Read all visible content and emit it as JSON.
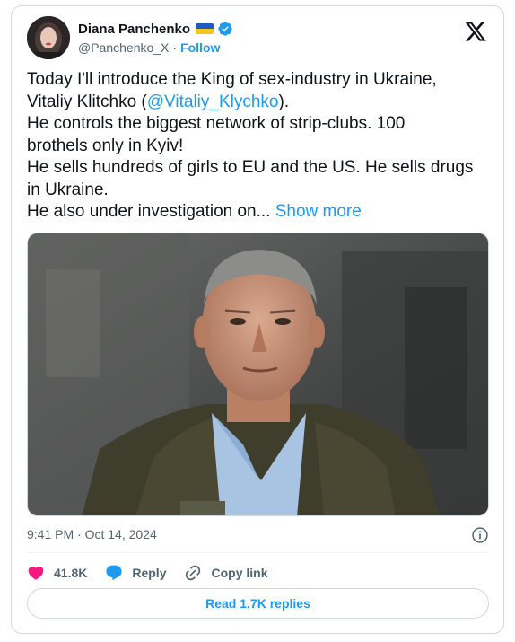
{
  "author": {
    "name": "Diana Panchenko",
    "handle": "@Panchenko_X",
    "separator": "·",
    "follow_label": "Follow",
    "flag_colors": [
      "#1d5bbf",
      "#f5c518"
    ],
    "verified_color": "#1d9bf0"
  },
  "tweet": {
    "line1": "Today I'll introduce the King of sex-industry in Ukraine,",
    "line2_prefix": "Vitaliy Klitchko (",
    "mention": "@Vitaliy_Klychko",
    "line2_suffix": ").",
    "line3": "He controls the biggest network of strip-clubs. 100",
    "line4": "brothels only in Kyiv!",
    "line5": "He sells hundreds of girls to EU and the US. He sells drugs",
    "line6": "in Ukraine.",
    "line7": "He also under investigation on...",
    "show_more": "Show more"
  },
  "media": {
    "alt": "photo"
  },
  "meta": {
    "timestamp": "9:41 PM · Oct 14, 2024"
  },
  "actions": {
    "likes": "41.8K",
    "reply_label": "Reply",
    "copy_link_label": "Copy link"
  },
  "read_replies_label": "Read 1.7K replies",
  "icons": {
    "x_logo": "x-logo-icon",
    "verified": "verified-badge-icon",
    "info": "info-icon",
    "heart": "heart-icon",
    "reply": "reply-bubble-icon",
    "link": "link-icon"
  },
  "colors": {
    "accent": "#1d9bf0",
    "heart": "#f91880",
    "secondary_text": "#536471",
    "border": "#cfd9de"
  }
}
